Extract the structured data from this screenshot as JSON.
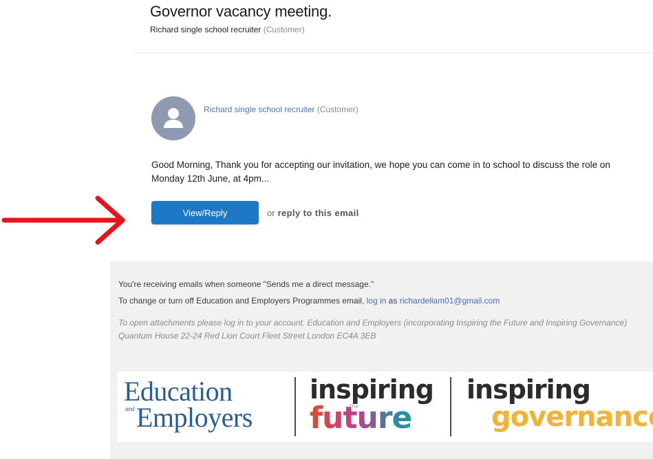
{
  "email": {
    "subject": "Governor vacancy meeting.",
    "sender_name": "Richard single school recruiter",
    "sender_role": "(Customer)"
  },
  "message": {
    "sender_name": "Richard single school recruiter",
    "sender_role": "(Customer)",
    "body": "Good Morning, Thank you for accepting our invitation, we hope you can come in to school to discuss the role on Monday 12th June, at 4pm...",
    "reply_button_label": "View/Reply",
    "or_label": "or",
    "reply_email_label": "reply to this email",
    "avatar_icon": "user-icon"
  },
  "annotation": {
    "arrow_color": "#e8141b",
    "arrow_icon": "right-arrow-icon"
  },
  "footer": {
    "receiving_text": "You're receiving emails when someone \"Sends me a direct message.\"",
    "change_text": "To change or turn off Education and Employers Programmes email,",
    "login_link": "log in",
    "as_text": "as",
    "email_address": "richardellam01@gmail.com",
    "attachments_text": "To open attachments please log in to your account. Education and Employers (incorporating Inspiring the Future and Inspiring Governance) Quantum House 22-24 Red Lion Court Fleet Street London EC4A 3EB"
  },
  "logos": {
    "ee_line1": "Education",
    "ee_and": "and",
    "ee_line2": "Employers",
    "if_word1": "inspiring",
    "if_the": "the",
    "if_word2": "future",
    "ig_word1": "inspiring",
    "ig_word2": "governance"
  },
  "colors": {
    "button_blue": "#1d78c6",
    "link_blue": "#3f6fb5",
    "footer_bg": "#f1f1f1"
  }
}
